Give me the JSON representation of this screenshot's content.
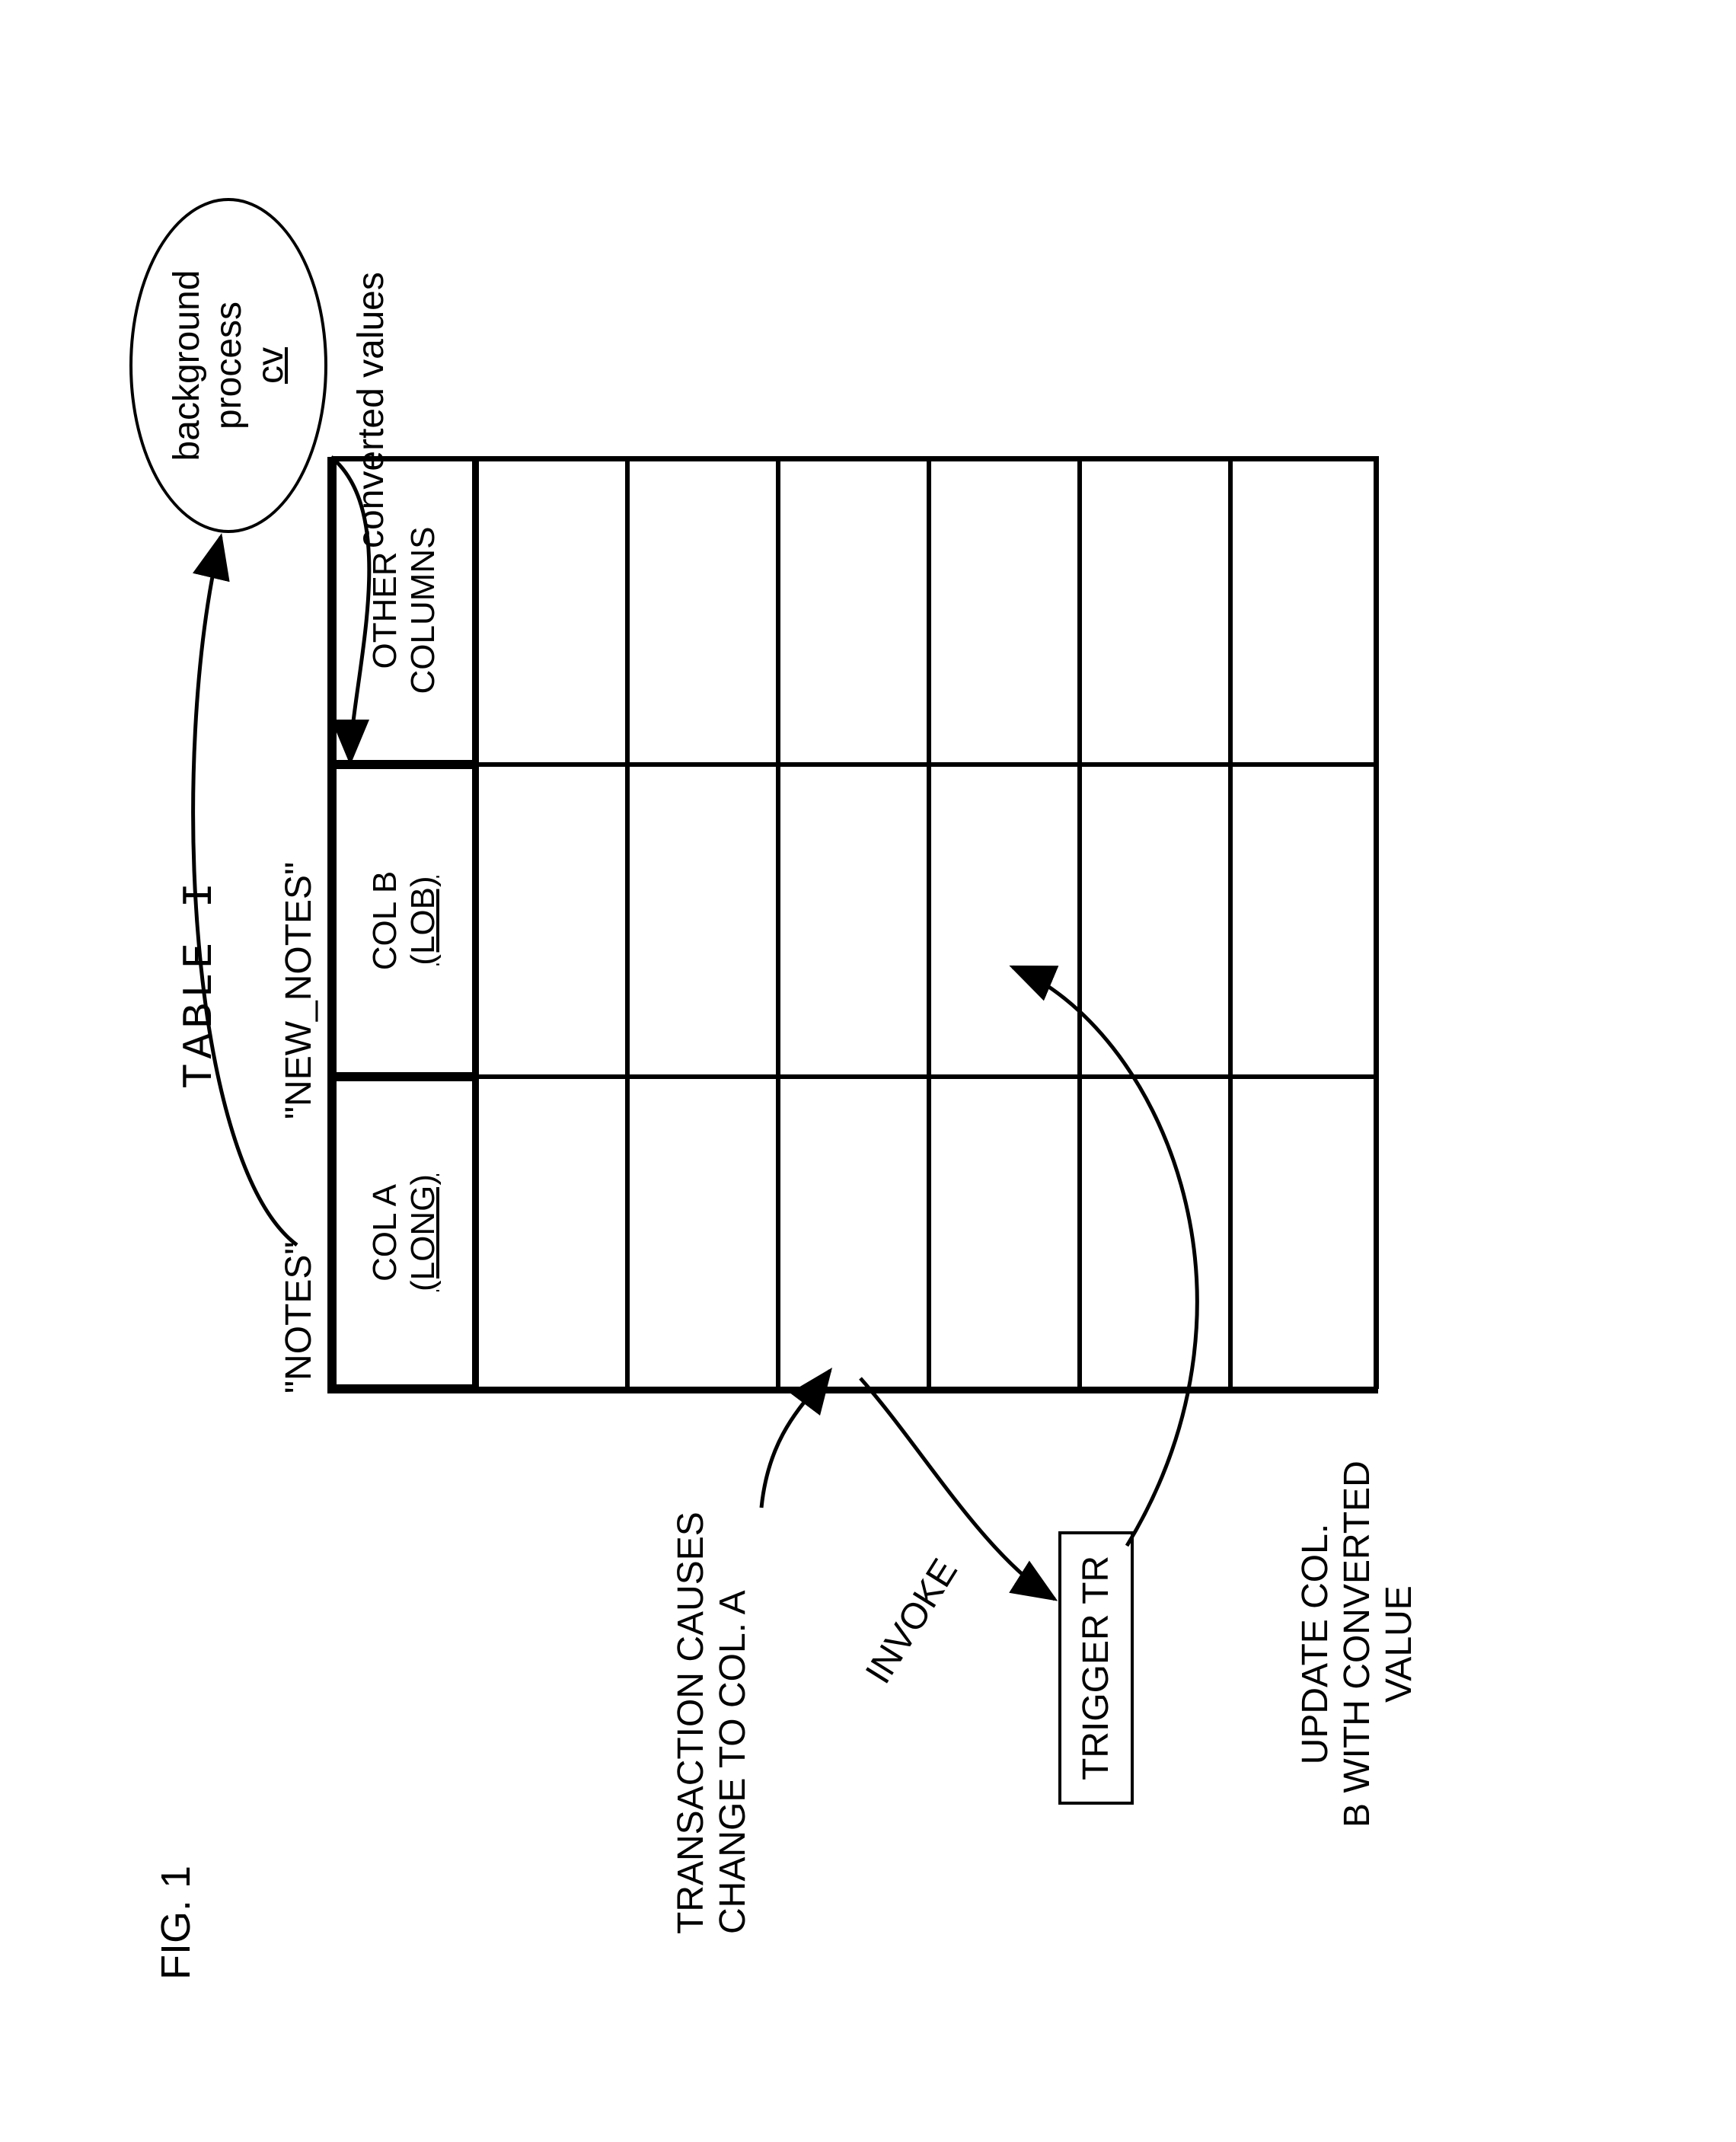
{
  "figure_label": "FIG. 1",
  "table": {
    "title": "TABLE I",
    "col_labels_above": {
      "colA": "\"NOTES\"",
      "colB": "\"NEW_NOTES\""
    },
    "headers": {
      "colA_line1": "COL A",
      "colA_line2": "(LONG)",
      "colB_line1": "COL B",
      "colB_line2": "(LOB)",
      "other_line1": "OTHER",
      "other_line2": "COLUMNS"
    }
  },
  "ellipse": {
    "line1": "background",
    "line2": "process",
    "line3": "cv"
  },
  "labels": {
    "converted_values": "converted values",
    "txn_line1": "TRANSACTION CAUSES",
    "txn_line2": "CHANGE TO COL. A",
    "invoke": "INVOKE",
    "trigger": "TRIGGER TR",
    "update_line1": "UPDATE COL.",
    "update_line2": "B WITH CONVERTED",
    "update_line3": "VALUE"
  }
}
